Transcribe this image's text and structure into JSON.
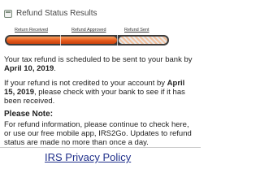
{
  "header": {
    "title": "Refund Status Results",
    "icon": "status-icon"
  },
  "tracker": {
    "steps": [
      {
        "label": "Return Received",
        "status": "complete"
      },
      {
        "label": "Refund Approved",
        "status": "complete"
      },
      {
        "label": "Refund Sent",
        "status": "pending"
      }
    ],
    "progress_fraction": 0.67,
    "colors": {
      "fill": "#e4571a",
      "track": "#3c3c3c"
    }
  },
  "message": {
    "line1_text": "Your tax refund is scheduled to be sent to your bank by ",
    "line1_date": "April 10, 2019",
    "line1_end": ".",
    "line2_text": "If your refund is not credited to your account by ",
    "line2_date": "April 15, 2019",
    "line2_end": ", please check with your bank to see if it has been received."
  },
  "note": {
    "heading": "Please Note:",
    "body": "For refund information, please continue to check here, or use our free mobile app, IRS2Go. Updates to refund status are made no more than once a day."
  },
  "footer": {
    "privacy_link": "IRS Privacy Policy",
    "link_color": "#1f2f8a"
  }
}
